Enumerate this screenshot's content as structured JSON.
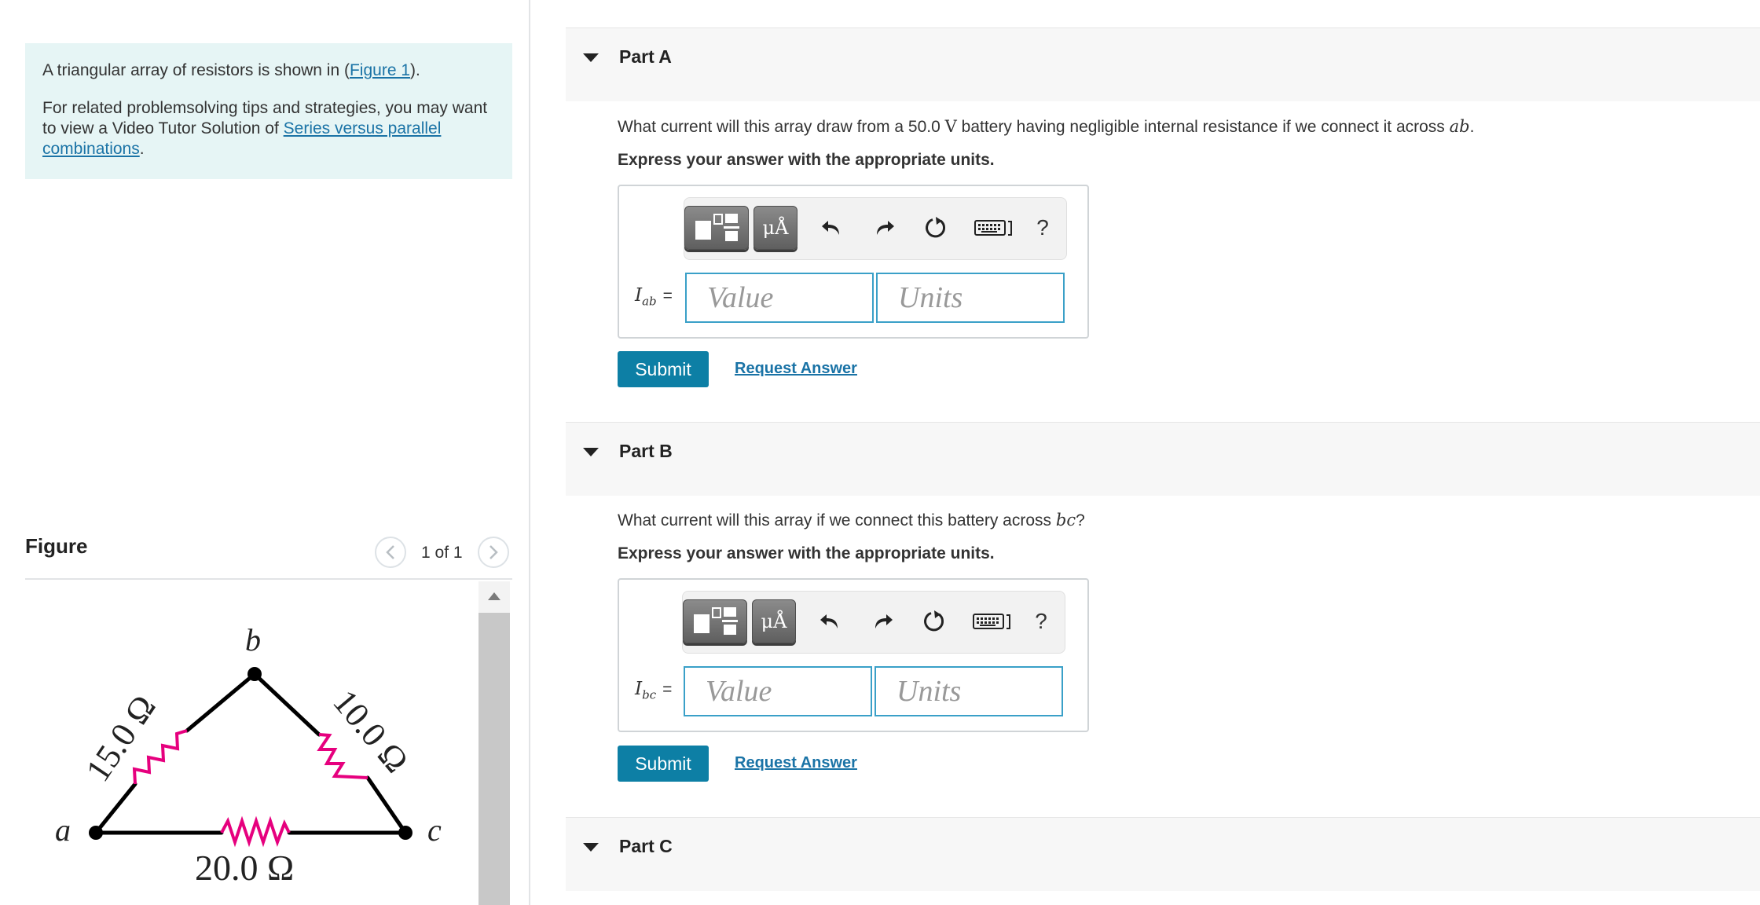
{
  "intro": {
    "line1_pre": "A triangular array of resistors is shown in (",
    "line1_link": "Figure 1",
    "line1_post": ").",
    "line2_pre": "For related problemsolving tips and strategies, you may want to view a Video Tutor Solution of ",
    "line2_link": "Series versus parallel combinations",
    "line2_post": "."
  },
  "figure": {
    "title": "Figure",
    "counter": "1 of 1",
    "labels": {
      "a": "a",
      "b": "b",
      "c": "c",
      "r_ab": "15.0 Ω",
      "r_bc": "10.0 Ω",
      "r_ac": "20.0 Ω"
    },
    "colors": {
      "resistor": "#e6007e",
      "wire": "#000000"
    }
  },
  "toolbar": {
    "units_btn": "μÅ",
    "help": "?"
  },
  "parts": [
    {
      "label": "Part A",
      "question_pre": "What current will this array draw from a 50.0 ",
      "question_unit": "V",
      "question_mid": " battery having negligible internal resistance if we connect it across ",
      "question_var": "ab",
      "question_post": ".",
      "instruction": "Express your answer with the appropriate units.",
      "var_main": "I",
      "var_sub": "ab",
      "eq": "=",
      "value_placeholder": "Value",
      "units_placeholder": "Units",
      "submit": "Submit",
      "request": "Request Answer"
    },
    {
      "label": "Part B",
      "question_pre": "What current will this array if we connect this battery across ",
      "question_var": "bc",
      "question_post": "?",
      "instruction": "Express your answer with the appropriate units.",
      "var_main": "I",
      "var_sub": "bc",
      "eq": "=",
      "value_placeholder": "Value",
      "units_placeholder": "Units",
      "submit": "Submit",
      "request": "Request Answer"
    },
    {
      "label": "Part C"
    }
  ],
  "colors": {
    "accent": "#0d7fa5",
    "link": "#1a73a6",
    "intro_bg": "#e6f5f5",
    "field_border": "#3aa0c8"
  }
}
